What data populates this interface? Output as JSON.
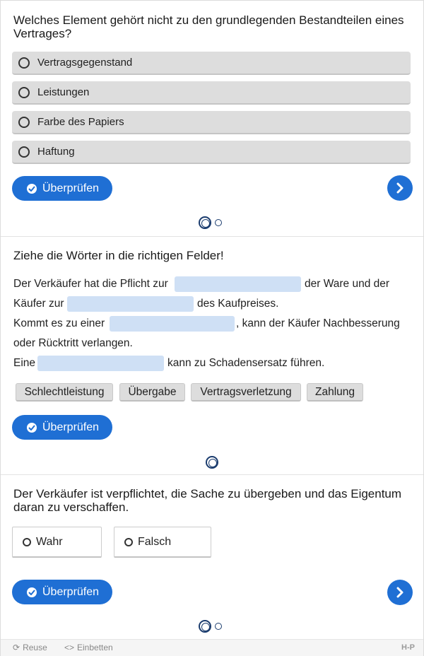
{
  "q1": {
    "question": "Welches Element gehört nicht zu den grundlegenden Bestandteilen eines Vertrages?",
    "options": [
      "Vertragsgegenstand",
      "Leistungen",
      "Farbe des Papiers",
      "Haftung"
    ],
    "check_label": "Überprüfen",
    "next_icon": "chevron-right-icon"
  },
  "q2": {
    "question": "Ziehe die Wörter in die richtigen Felder!",
    "lines": {
      "l1a": "Der Verkäufer hat die Pflicht zur",
      "l1b": "der Ware und der",
      "l2a": "Käufer zur",
      "l2b": "des Kaufpreises.",
      "l3a": "Kommt es zu einer",
      "l3b": ", kann der Käufer Nachbesserung",
      "l4": "oder Rücktritt verlangen.",
      "l5a": "Eine",
      "l5b": "kann zu Schadensersatz führen."
    },
    "words": [
      "Schlechtleistung",
      "Übergabe",
      "Vertragsverletzung",
      "Zahlung"
    ],
    "check_label": "Überprüfen"
  },
  "q3": {
    "question": "Der Verkäufer ist verpflichtet, die Sache zu übergeben und das Eigentum daran zu verschaffen.",
    "true_label": "Wahr",
    "false_label": "Falsch",
    "check_label": "Überprüfen",
    "next_icon": "chevron-right-icon"
  },
  "footer": {
    "reuse_label": "Reuse",
    "embed_label": "Einbetten",
    "logo_text": "H-P"
  },
  "colors": {
    "accent": "#1f6fd4",
    "option_bg": "#dddddd",
    "blank_bg": "#cfe0f5"
  }
}
